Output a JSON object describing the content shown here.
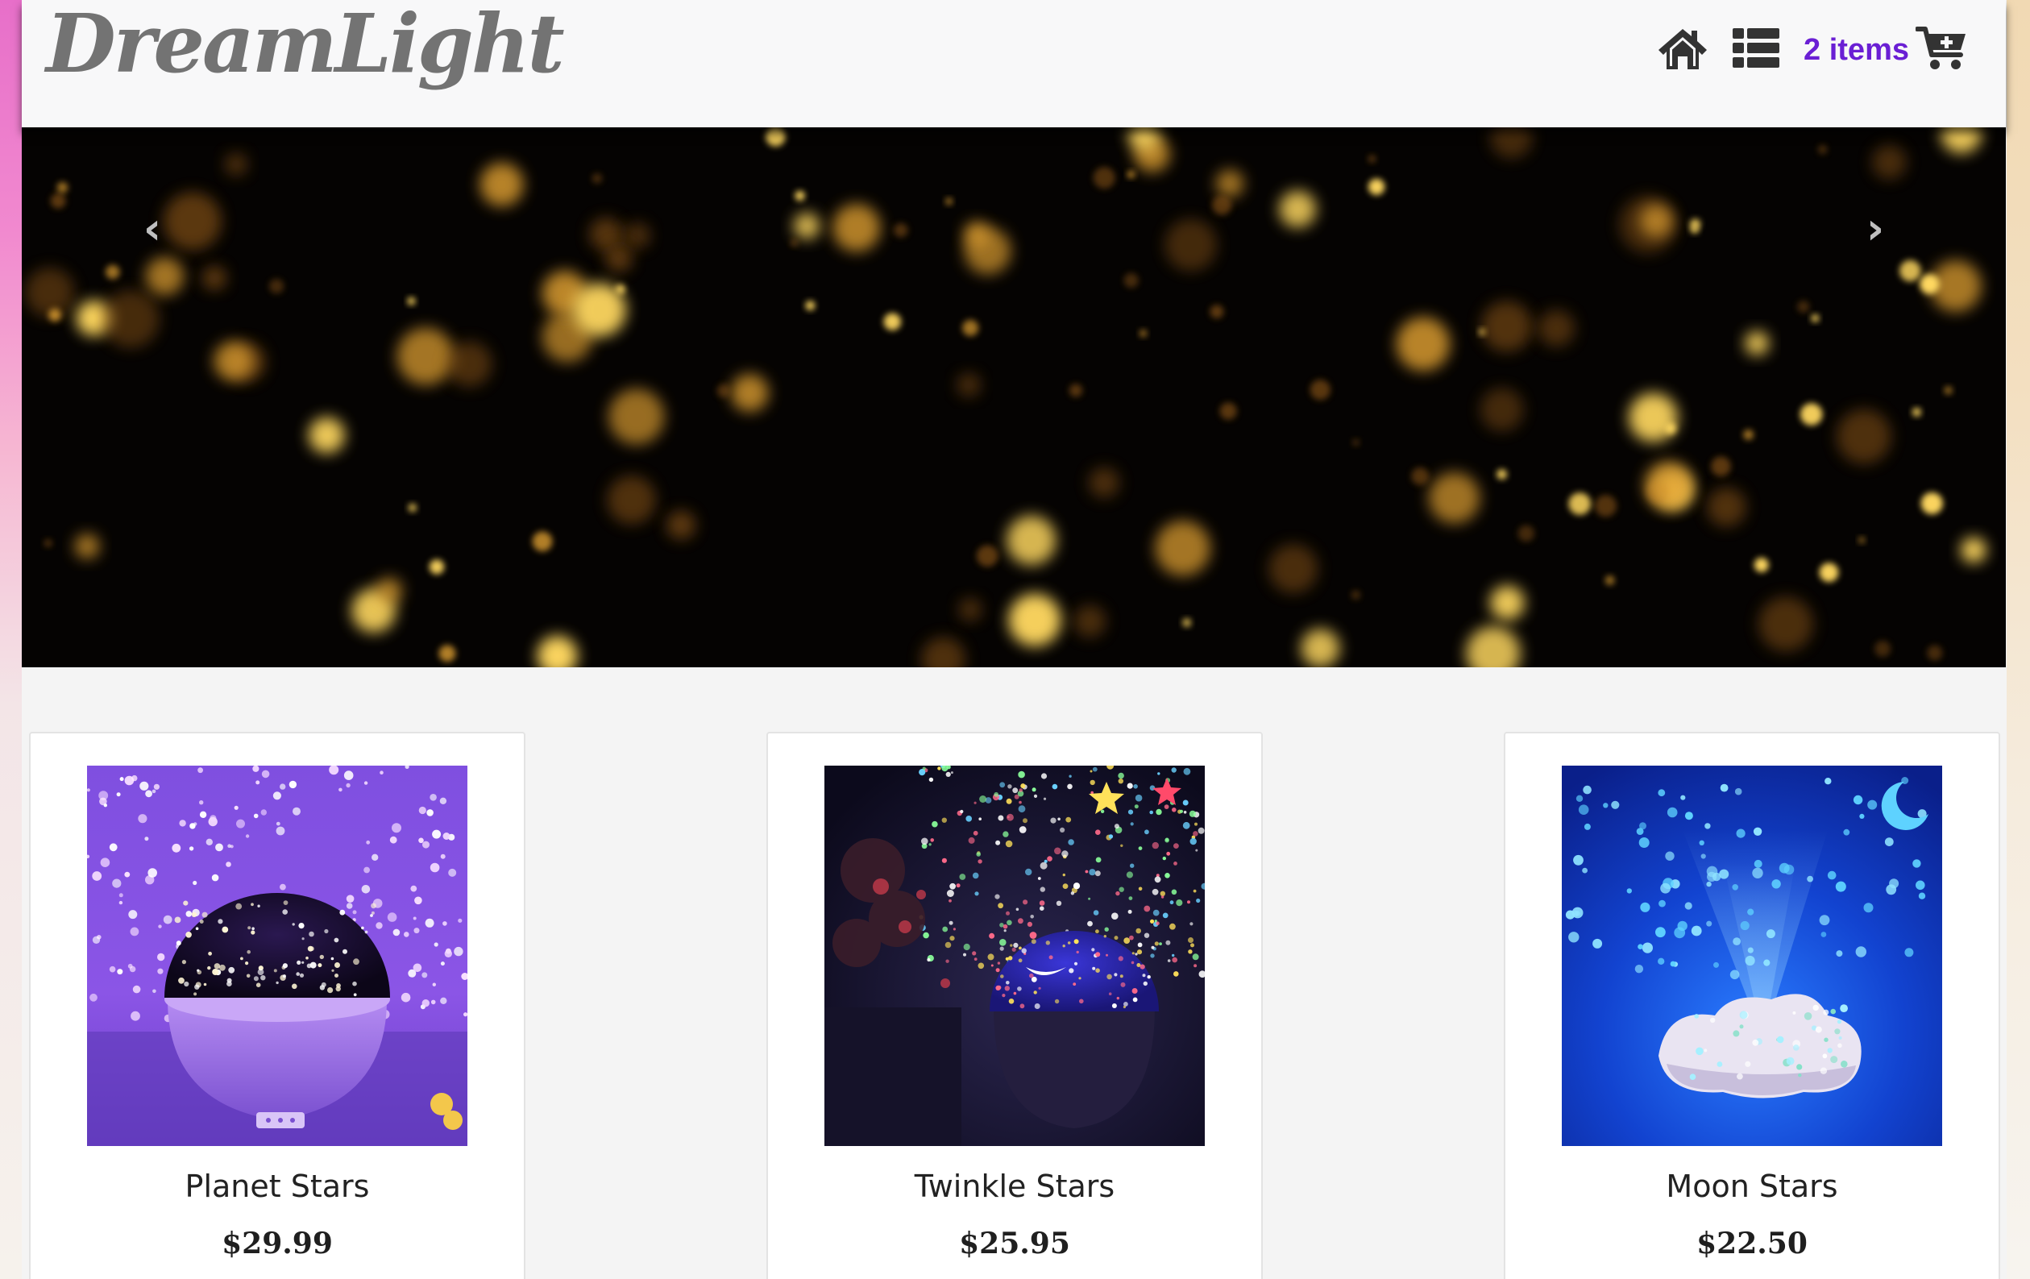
{
  "header": {
    "brand": "DreamLight",
    "home_icon": "home-icon",
    "list_icon": "list-icon",
    "cart_count_label": "2 items",
    "cart_icon": "cart-plus-icon",
    "accent_color": "#6a1fd4"
  },
  "hero": {
    "prev_icon": "chevron-left-icon",
    "next_icon": "chevron-right-icon",
    "prev_glyph": "‹",
    "next_glyph": "›"
  },
  "products": [
    {
      "name": "Planet Stars",
      "price": "$29.99"
    },
    {
      "name": "Twinkle Stars",
      "price": "$25.95"
    },
    {
      "name": "Moon Stars",
      "price": "$22.50"
    }
  ]
}
